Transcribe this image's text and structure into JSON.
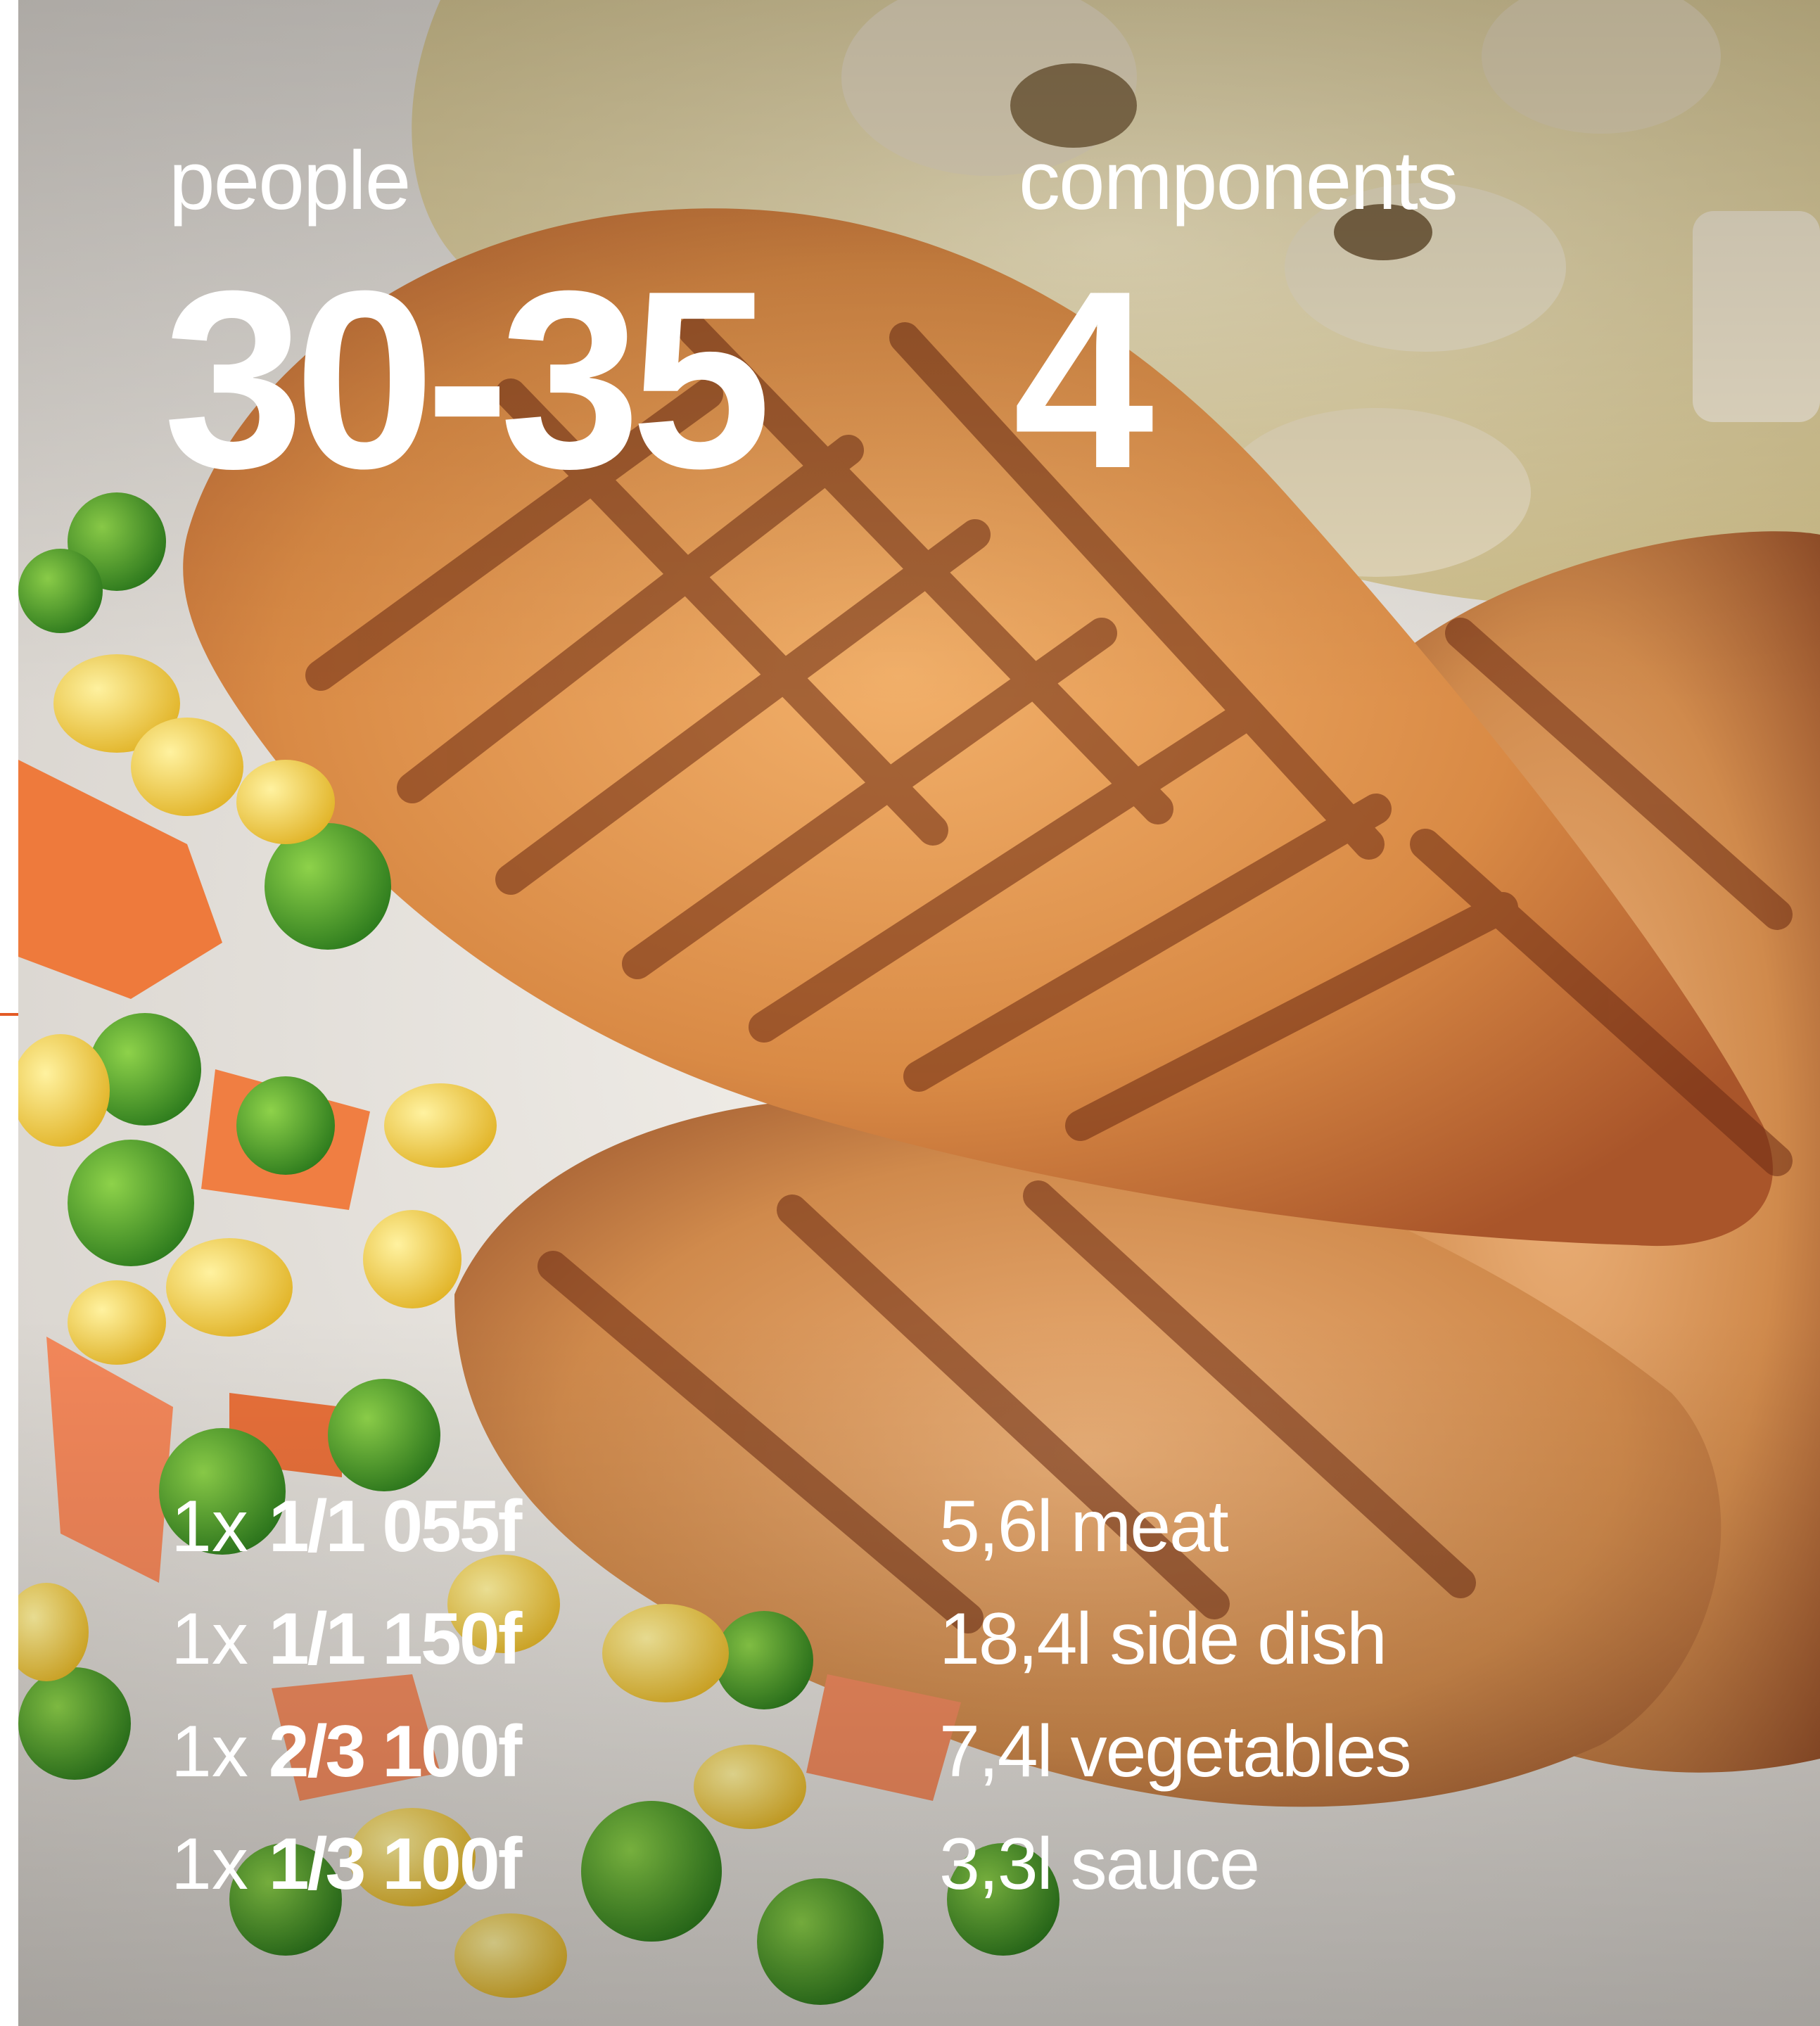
{
  "people": {
    "label": "people",
    "value": "30-35"
  },
  "components": {
    "label": "components",
    "value": "4"
  },
  "pans": [
    {
      "count": "1x",
      "size": "1/1 055f"
    },
    {
      "count": "1x",
      "size": "1/1 150f"
    },
    {
      "count": "1x",
      "size": "2/3 100f"
    },
    {
      "count": "1x",
      "size": "1/3 100f"
    }
  ],
  "component_list": [
    {
      "text": "5,6l meat"
    },
    {
      "text": "18,4l side dish"
    },
    {
      "text": "7,4l vegetables"
    },
    {
      "text": "3,3l sauce"
    }
  ],
  "colors": {
    "accent": "#e35a25",
    "text": "#ffffff"
  }
}
